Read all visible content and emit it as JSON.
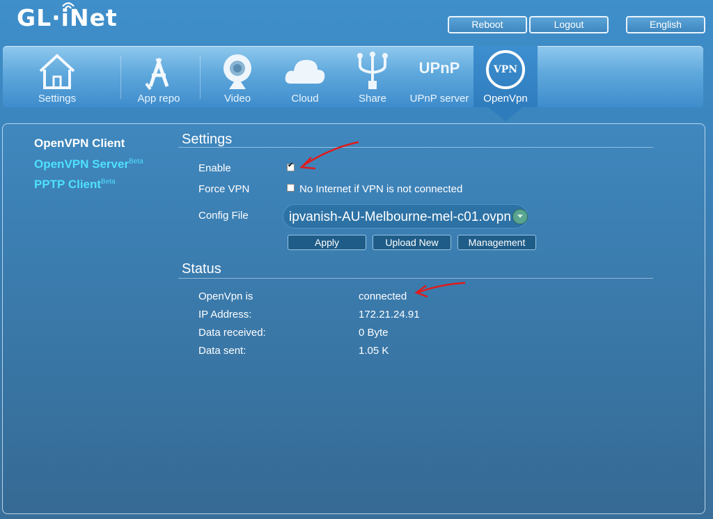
{
  "brand": {
    "logo_text": "GL·iNet"
  },
  "topbar": {
    "reboot": "Reboot",
    "logout": "Logout",
    "language": "English"
  },
  "nav": [
    {
      "label": "Settings",
      "icon": "home-icon"
    },
    {
      "label": "App repo",
      "icon": "app-store-icon"
    },
    {
      "label": "Video",
      "icon": "webcam-icon"
    },
    {
      "label": "Cloud",
      "icon": "cloud-icon"
    },
    {
      "label": "Share",
      "icon": "usb-icon"
    },
    {
      "label": "UPnP server",
      "icon": "upnp-icon",
      "icon_text": "UPnP"
    },
    {
      "label": "OpenVpn",
      "icon": "vpn-icon",
      "icon_text": "VPN",
      "active": true
    }
  ],
  "sidebar": {
    "client": "OpenVPN Client",
    "server": "OpenVPN Server",
    "pptp": "PPTP Client",
    "beta": "Beta"
  },
  "settings": {
    "heading": "Settings",
    "enable_label": "Enable",
    "enable_checked": true,
    "force_label": "Force VPN",
    "force_checked": false,
    "force_text": "No Internet if VPN is not connected",
    "config_label": "Config File",
    "config_value": "ipvanish-AU-Melbourne-mel-c01.ovpn",
    "apply": "Apply",
    "upload": "Upload New",
    "management": "Management"
  },
  "status": {
    "heading": "Status",
    "rows": [
      {
        "label": "OpenVpn is",
        "value": "connected"
      },
      {
        "label": "IP Address:",
        "value": "172.21.24.91"
      },
      {
        "label": "Data received:",
        "value": "0 Byte"
      },
      {
        "label": "Data sent:",
        "value": "1.05 K"
      }
    ]
  },
  "colors": {
    "annotation": "#e01b1b",
    "sidebar_link": "#4fe0ff",
    "button_dark": "#1f5d88"
  }
}
